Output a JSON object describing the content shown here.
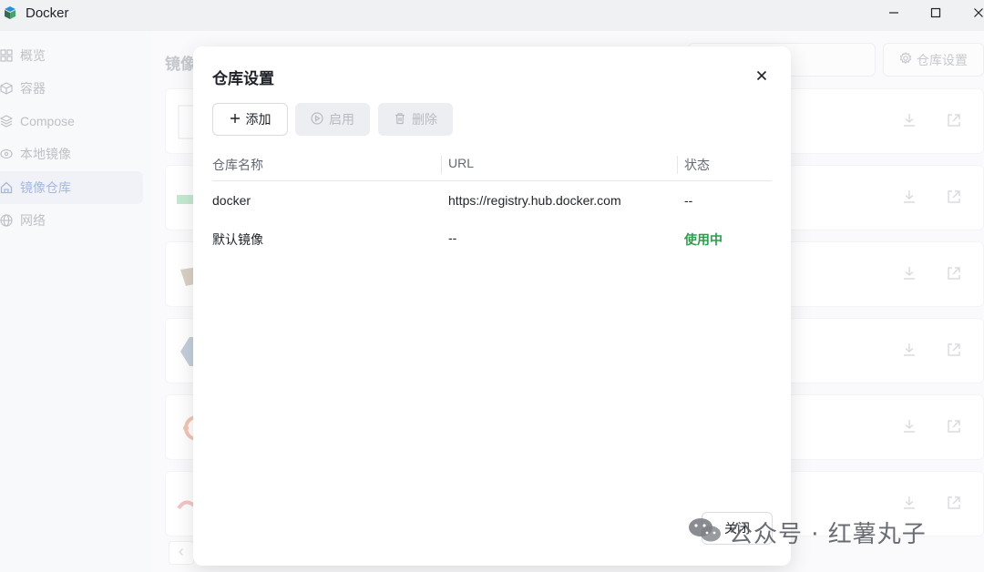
{
  "window": {
    "title": "Docker",
    "minimize_glyph": "—",
    "maximize_glyph": "☐",
    "close_glyph": "✕"
  },
  "sidebar": {
    "items": [
      {
        "label": "概览",
        "icon": "grid-icon",
        "active": false
      },
      {
        "label": "容器",
        "icon": "cube-icon",
        "active": false
      },
      {
        "label": "Compose",
        "icon": "layers-icon",
        "active": false
      },
      {
        "label": "本地镜像",
        "icon": "disc-icon",
        "active": false
      },
      {
        "label": "镜像仓库",
        "icon": "home-icon",
        "active": true
      },
      {
        "label": "网络",
        "icon": "globe-icon",
        "active": false
      }
    ]
  },
  "main": {
    "title": "镜像",
    "repo_settings_label": "仓库设置"
  },
  "dialog": {
    "title": "仓库设置",
    "add_label": "添加",
    "enable_label": "启用",
    "delete_label": "删除",
    "columns": [
      "仓库名称",
      "URL",
      "状态"
    ],
    "rows": [
      {
        "name": "docker",
        "url": "https://registry.hub.docker.com",
        "status": "--"
      },
      {
        "name": "默认镜像",
        "url": "--",
        "status": "使用中"
      }
    ],
    "close_label": "关闭"
  },
  "watermark": {
    "text": "公众号 · 红薯丸子"
  },
  "colors": {
    "status_active": "#2a9f48",
    "sidebar_active": "#7892c8"
  }
}
